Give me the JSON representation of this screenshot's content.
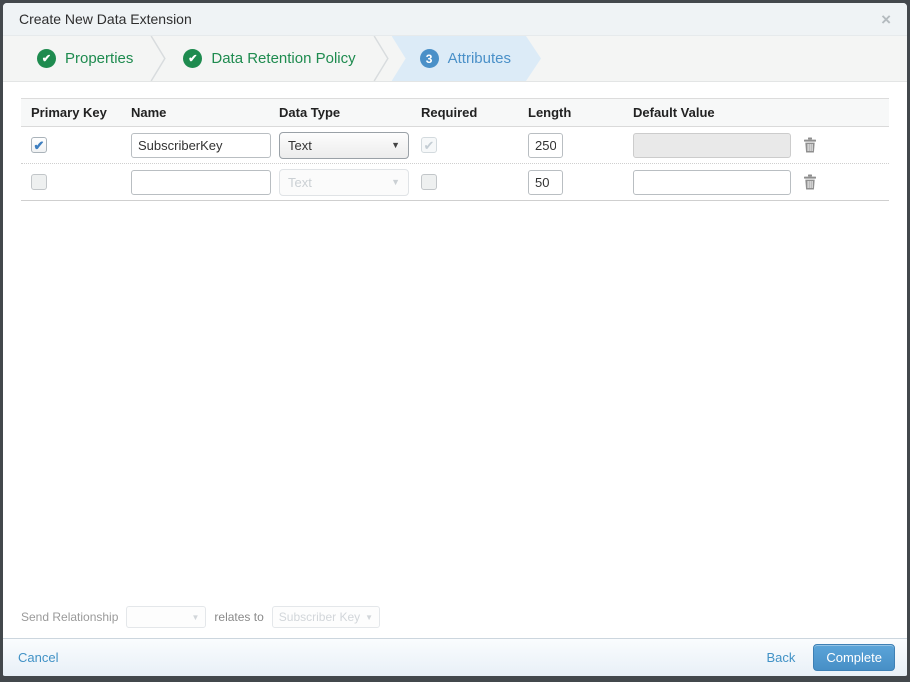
{
  "dialog": {
    "title": "Create New Data Extension",
    "close_icon": "×"
  },
  "wizard": {
    "steps": [
      {
        "label": "Properties",
        "status": "complete"
      },
      {
        "label": "Data Retention Policy",
        "status": "complete"
      },
      {
        "label": "Attributes",
        "status": "active",
        "number": "3"
      }
    ]
  },
  "table": {
    "headers": [
      "Primary Key",
      "Name",
      "Data Type",
      "Required",
      "Length",
      "Default Value"
    ],
    "rows": [
      {
        "primary_key": true,
        "name": "SubscriberKey",
        "data_type": "Text",
        "required": true,
        "required_disabled": true,
        "length": "250",
        "default_value": "",
        "default_value_disabled": true
      },
      {
        "primary_key": false,
        "name": "",
        "data_type": "Text",
        "data_type_disabled": true,
        "required": false,
        "length": "50",
        "default_value": "",
        "default_value_disabled": false
      }
    ]
  },
  "relationship": {
    "label": "Send Relationship",
    "relates_label": "relates to",
    "target_field": "Subscriber Key"
  },
  "footer": {
    "cancel_label": "Cancel",
    "back_label": "Back",
    "complete_label": "Complete"
  },
  "colors": {
    "step_complete_green": "#1e8b4f",
    "step_active_blue": "#4a90c8",
    "active_band_bg": "#dcebf7",
    "accent_blue": "#4192c6",
    "primary_button_blue": "#478fc6"
  }
}
